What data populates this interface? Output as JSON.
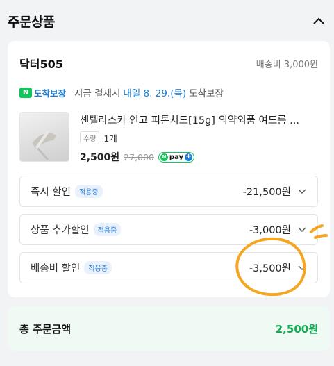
{
  "header": {
    "title": "주문상품",
    "collapse_icon": "chevron-up-icon"
  },
  "store": {
    "name": "닥터505",
    "shipping_fee": "배송비 3,000원"
  },
  "delivery": {
    "logo_badge": "N",
    "logo_label": "도착보장",
    "text": "지금 결제시",
    "date": "내일 8. 29.(목)",
    "suffix": "도착보장"
  },
  "product": {
    "name": "센텔라스카 연고 피톤치드[15g] 의약외품 여드름 ...",
    "qty_badge": "수량",
    "qty": "1개",
    "price": "2,500원",
    "original_price": "27,000",
    "npay_label": "pay",
    "npay_n": "N",
    "npay_plus": "+"
  },
  "discounts": [
    {
      "label": "즉시 할인",
      "badge": "적용중",
      "amount": "-21,500원"
    },
    {
      "label": "상품 추가할인",
      "badge": "적용중",
      "amount": "-3,000원"
    },
    {
      "label": "배송비 할인",
      "badge": "적용중",
      "amount": "-3,500원"
    }
  ],
  "total": {
    "label": "총 주문금액",
    "amount": "2,500원"
  },
  "colors": {
    "accent_green": "#0fae52",
    "accent_blue": "#1d7fd6",
    "annotation_orange": "#f5a623"
  }
}
